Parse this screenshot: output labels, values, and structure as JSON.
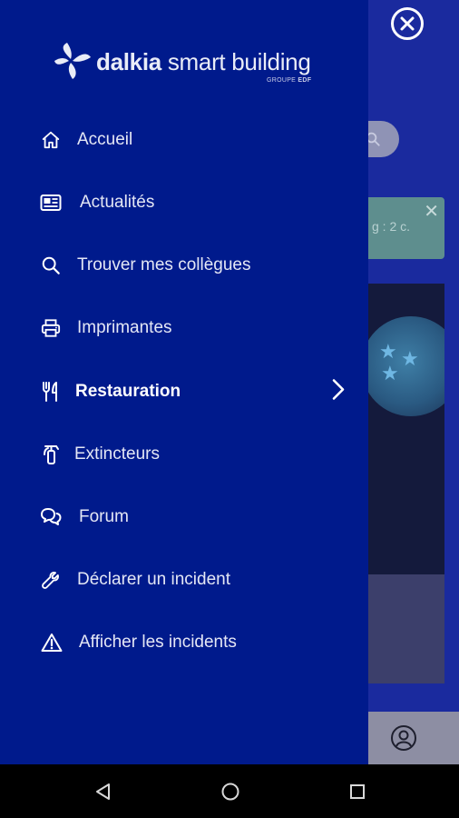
{
  "logo": {
    "brand_bold": "dalkia",
    "brand_rest": " smart building",
    "group_prefix": "GROUPE ",
    "group_bold": "EDF"
  },
  "background": {
    "notification_text": "g : 2 c.",
    "notification_close": "✕"
  },
  "menu": {
    "items": [
      {
        "label": "Accueil",
        "icon": "home-icon"
      },
      {
        "label": "Actualités",
        "icon": "news-icon"
      },
      {
        "label": "Trouver mes collègues",
        "icon": "search-icon"
      },
      {
        "label": "Imprimantes",
        "icon": "printer-icon"
      },
      {
        "label": "Restauration",
        "icon": "utensils-icon",
        "has_submenu": true
      },
      {
        "label": "Extincteurs",
        "icon": "fire-extinguisher-icon"
      },
      {
        "label": "Forum",
        "icon": "chat-bubbles-icon"
      },
      {
        "label": "Déclarer un incident",
        "icon": "wrench-icon"
      },
      {
        "label": "Afficher les incidents",
        "icon": "warning-icon"
      }
    ]
  },
  "colors": {
    "drawer": "#001a8c",
    "text": "#e4e7f5",
    "navbar": "#000000"
  }
}
